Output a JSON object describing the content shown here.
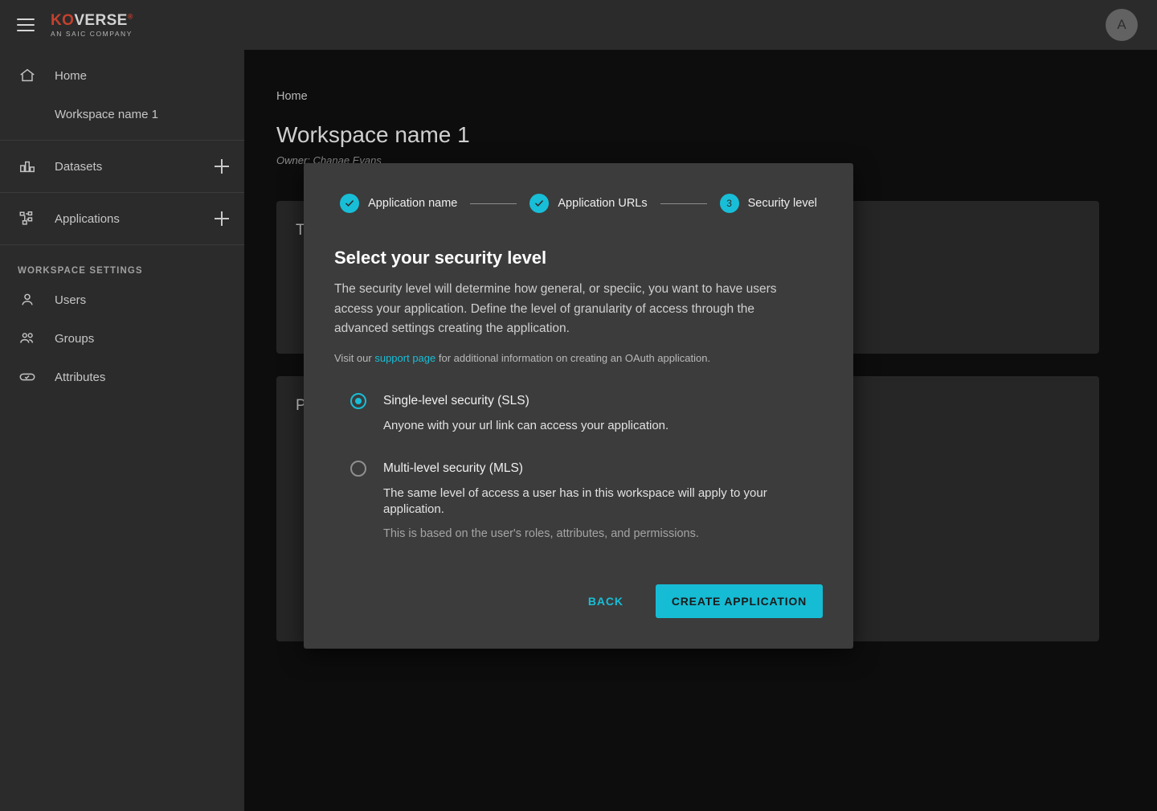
{
  "topbar": {
    "menu_icon": "hamburger-menu-icon",
    "logo_primary_1": "KO",
    "logo_primary_2": "VERSE",
    "logo_registered": "®",
    "logo_tagline": "AN SAIC COMPANY",
    "avatar_initial": "A"
  },
  "sidebar": {
    "items": [
      {
        "label": "Home",
        "icon": "home-icon"
      },
      {
        "label": "Workspace name 1",
        "icon": ""
      },
      {
        "label": "Datasets",
        "icon": "datasets-icon",
        "add": "+"
      },
      {
        "label": "Applications",
        "icon": "applications-icon",
        "add": "+"
      }
    ],
    "section_title": "WORKSPACE SETTINGS",
    "settings_items": [
      {
        "label": "Users",
        "icon": "user-icon"
      },
      {
        "label": "Groups",
        "icon": "group-icon"
      },
      {
        "label": "Attributes",
        "icon": "attributes-tag-icon"
      }
    ]
  },
  "main": {
    "breadcrumb": "Home",
    "title": "Workspace name 1",
    "owner": "Owner: Chanae Evans",
    "card_1_title": "Ta",
    "card_2_title": "P"
  },
  "modal": {
    "steps": [
      {
        "label": "Application name",
        "state": "complete",
        "marker": "check-icon"
      },
      {
        "label": "Application URLs",
        "state": "complete",
        "marker": "check-icon"
      },
      {
        "label": "Security level",
        "state": "current",
        "marker": "3"
      }
    ],
    "heading": "Select your security level",
    "paragraph": "The security level will determine how general, or speciic, you want to have users access your application. Define the level of granularity of access through the advanced settings creating the application.",
    "note_before": "Visit our ",
    "note_link": "support page",
    "note_after": " for additional information on creating an OAuth application.",
    "options": [
      {
        "title": "Single-level security (SLS)",
        "desc": "Anyone with your url link can access your application.",
        "sub": "",
        "selected": true
      },
      {
        "title": "Multi-level security (MLS)",
        "desc": "The same level of access a user has in this workspace will apply to your application.",
        "sub": "This is based on the user's roles, attributes, and permissions.",
        "selected": false
      }
    ],
    "back_label": "BACK",
    "create_label": "CREATE APPLICATION"
  },
  "colors": {
    "accent": "#18bed7",
    "brand_red": "#c4412e",
    "surface": "#2b2b2b",
    "modal_surface": "#3c3c3c",
    "page_bg": "#0d0d0d",
    "card_bg": "#262626"
  }
}
